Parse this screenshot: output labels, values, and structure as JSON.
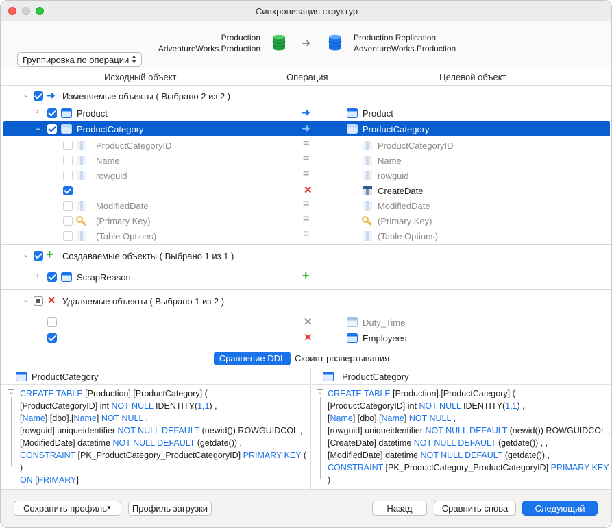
{
  "window": {
    "title": "Синхронизация структур"
  },
  "header": {
    "source_line1": "Production",
    "source_line2": "AdventureWorks.Production",
    "target_line1": "Production Replication",
    "target_line2": "AdventureWorks.Production",
    "group_select": "Группировка по операции"
  },
  "columns": {
    "source": "Исходный объект",
    "operation": "Операция",
    "target": "Целевой объект"
  },
  "groups": {
    "modified": "Изменяемые объекты ( Выбрано 2 из 2 )",
    "created": "Создаваемые объекты ( Выбрано 1 из 1 )",
    "deleted": "Удаляемые объекты ( Выбрано 1 из 2 )"
  },
  "rows": {
    "product_src": "Product",
    "product_tgt": "Product",
    "pc_src": "ProductCategory",
    "pc_tgt": "ProductCategory",
    "f1_src": "ProductCategoryID",
    "f1_tgt": "ProductCategoryID",
    "f2_src": "Name",
    "f2_tgt": "Name",
    "f3_src": "rowguid",
    "f3_tgt": "rowguid",
    "f4_tgt": "CreateDate",
    "f5_src": "ModifiedDate",
    "f5_tgt": "ModifiedDate",
    "f6_src": "(Primary Key)",
    "f6_tgt": "(Primary Key)",
    "f7_src": "(Table Options)",
    "f7_tgt": "(Table Options)",
    "scrap_src": "ScrapReason",
    "del1_tgt": "Duty_Time",
    "del2_tgt": "Employees"
  },
  "tabs": {
    "ddl": "Сравнение DDL",
    "script": "Скрипт развертывания"
  },
  "ddl": {
    "left_title": "ProductCategory",
    "right_title": "ProductCategory",
    "l1a": "CREATE TABLE",
    "l1b": " [Production].[ProductCategory] (",
    "l2a": "[ProductCategoryID] int ",
    "l2b": "NOT NULL",
    "l2c": " IDENTITY(",
    "l2d": "1",
    "l2e": ",",
    "l2f": "1",
    "l2g": ") ,",
    "l3a": "[",
    "l3b": "Name",
    "l3c": "] [dbo].[",
    "l3d": "Name",
    "l3e": "] ",
    "l3f": "NOT NULL",
    "l3g": " ,",
    "l4a": "[rowguid] uniqueidentifier ",
    "l4b": "NOT NULL DEFAULT",
    "l4c": " (newid()) ROWGUIDCOL ,",
    "l5a": "[ModifiedDate] datetime ",
    "l5b": "NOT NULL DEFAULT",
    "l5c": " (getdate()) ,",
    "l6a": "CONSTRAINT",
    "l6b": " [PK_ProductCategory_ProductCategoryID] ",
    "l6c": "PRIMARY KEY",
    "l6d": " (",
    "l7": ")",
    "l8a": "ON",
    "l8b": " [",
    "l8c": "PRIMARY",
    "l8d": "]",
    "r5a": "[CreateDate] datetime ",
    "r5b": "NOT NULL DEFAULT",
    "r5c": " (getdate()) , ,",
    "r6a": "[ModifiedDate] datetime ",
    "r6b": "NOT NULL DEFAULT",
    "r6c": " (getdate()) ,"
  },
  "footer": {
    "save_profile": "Сохранить профиль",
    "load_profile": "Профиль загрузки",
    "back": "Назад",
    "compare_again": "Сравнить снова",
    "next": "Следующий"
  },
  "colors": {
    "accent": "#1a73e8",
    "selection": "#0a5fd0",
    "delete": "#e53935",
    "create": "#2fb02a"
  }
}
